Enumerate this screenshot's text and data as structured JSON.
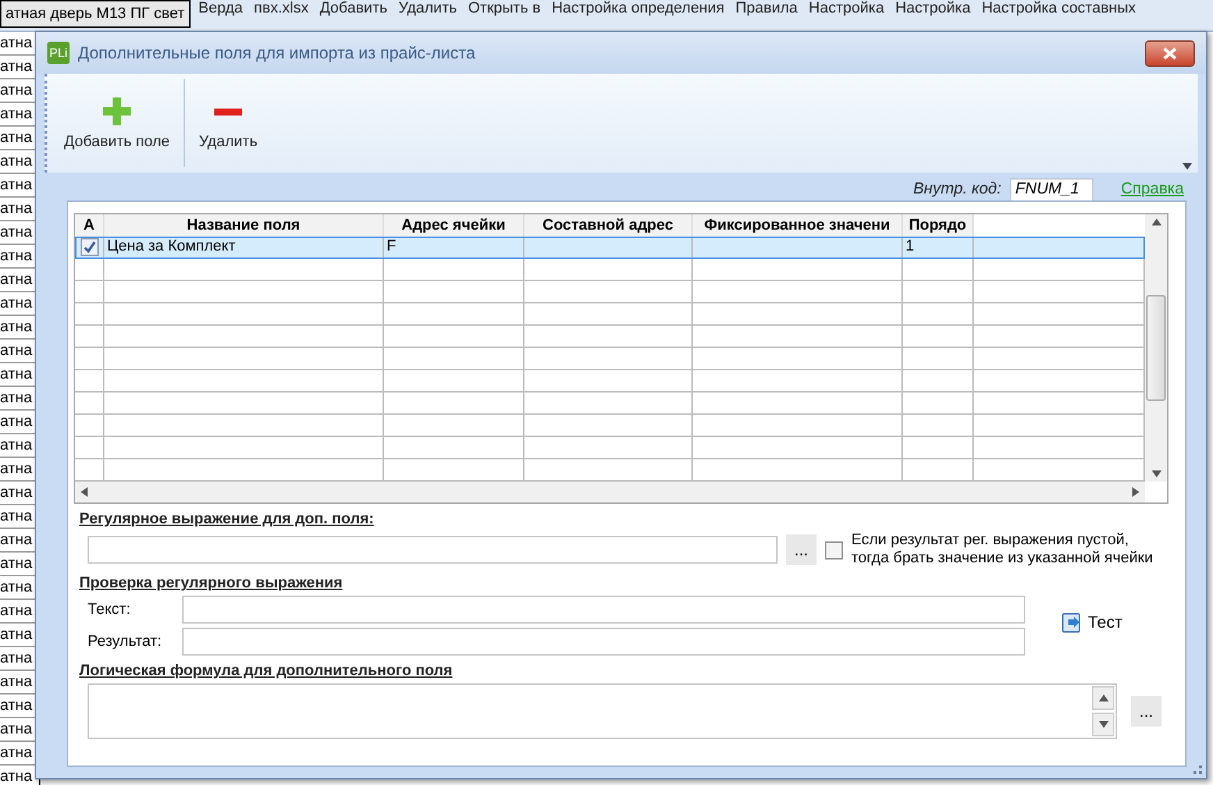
{
  "background": {
    "header_cell": "атная дверь М13 ПГ свет",
    "ribbon": [
      "Верда",
      "пвх.xlsx",
      "Добавить",
      "Удалить",
      "Открыть в",
      "Настройка определения",
      "Правила",
      "Настройка",
      "Настройка",
      "Настройка составных"
    ],
    "row_cells": [
      "атна",
      "атна",
      "атна",
      "атна",
      "атна",
      "атна",
      "атна",
      "атна",
      "атна",
      "атна",
      "атна",
      "атна",
      "атна",
      "атна",
      "атна",
      "атна",
      "атна",
      "атна",
      "атна",
      "атна",
      "атна",
      "атна",
      "атна",
      "атна",
      "атна",
      "атна",
      "атна",
      "атна",
      "атна",
      "атна",
      "атна",
      "атна"
    ]
  },
  "window": {
    "title": "Дополнительные поля для импорта из прайс-листа",
    "app_badge": "PLi"
  },
  "toolbar": {
    "buttons": [
      {
        "label": "Добавить поле",
        "kind": "add"
      },
      {
        "label": "Удалить",
        "kind": "remove"
      }
    ]
  },
  "code": {
    "label": "Внутр. код:",
    "value": "FNUM_1"
  },
  "help_link": "Справка",
  "table": {
    "columns": [
      "A",
      "Название поля",
      "Адрес ячейки",
      "Составной адрес",
      "Фиксированное значени",
      "Порядо"
    ],
    "rows": [
      {
        "active": true,
        "selected": true,
        "name": "Цена за Комплект",
        "address": "F",
        "order": "1"
      }
    ]
  },
  "regex": {
    "heading": "Регулярное выражение для доп. поля:",
    "button": "...",
    "checkbox": {
      "label": "Если результат рег. выражения пустой,\nтогда брать значение из указанной ячейки",
      "checked": false
    }
  },
  "test": {
    "heading": "Проверка регулярного выражения",
    "fields": [
      {
        "label": "Текст:"
      },
      {
        "label": "Результат:"
      }
    ],
    "button": "Тест"
  },
  "formula": {
    "heading": "Логическая формула для дополнительного поля",
    "button": "..."
  }
}
